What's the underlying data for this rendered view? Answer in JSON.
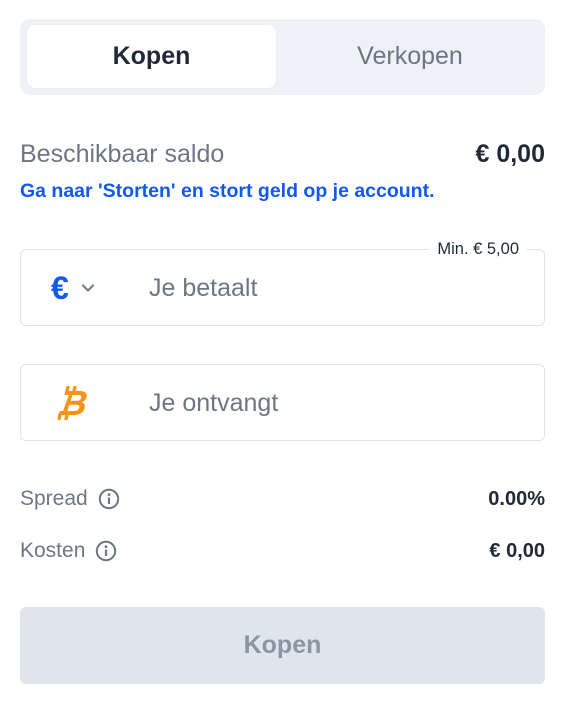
{
  "tabs": {
    "buy_label": "Kopen",
    "sell_label": "Verkopen",
    "active": "buy"
  },
  "balance": {
    "label": "Beschikbaar saldo",
    "value": "€ 0,00",
    "deposit_hint": "Ga naar 'Storten' en stort geld op je account."
  },
  "pay_field": {
    "min_label": "Min. € 5,00",
    "currency_symbol": "€",
    "currency_icon": "euro-icon",
    "dropdown_icon": "chevron-down-icon",
    "placeholder": "Je betaalt",
    "value": ""
  },
  "receive_field": {
    "asset_icon": "bitcoin-icon",
    "placeholder": "Je ontvangt",
    "value": ""
  },
  "stats": {
    "spread_label": "Spread",
    "spread_value": "0.00%",
    "costs_label": "Kosten",
    "costs_value": "€ 0,00",
    "info_icon": "info-icon"
  },
  "submit": {
    "label": "Kopen",
    "disabled": true
  },
  "colors": {
    "accent_blue": "#1259f0",
    "bitcoin_orange": "#f7931a",
    "muted_text": "#6b7785",
    "primary_text": "#1f2937",
    "disabled_button_bg": "#dfe5ec",
    "tabs_bg": "#eef1f5"
  }
}
